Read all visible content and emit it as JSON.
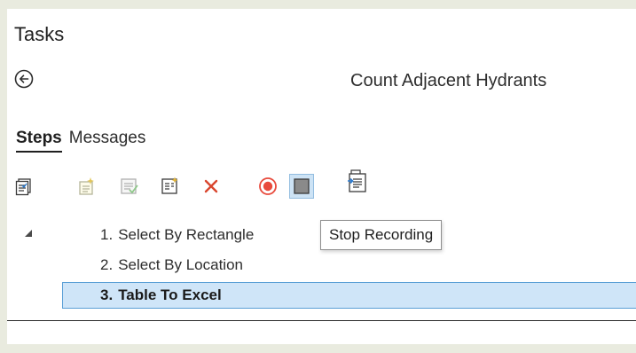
{
  "pane": {
    "title": "Tasks",
    "task_name": "Count Adjacent Hydrants"
  },
  "tabs": [
    {
      "label": "Steps",
      "active": true
    },
    {
      "label": "Messages",
      "active": false
    }
  ],
  "toolbar": {
    "icons": [
      "task-properties-icon",
      "insert-step-icon",
      "edit-step-icon",
      "step-properties-icon",
      "delete-step-icon",
      "record-icon",
      "stop-recording-icon",
      "paste-step-icon"
    ],
    "accent_record": "#e84a3c",
    "accent_delete": "#d9462e"
  },
  "tooltip": {
    "text": "Stop Recording"
  },
  "steps": [
    {
      "num": "1.",
      "label": "Select By Rectangle",
      "selected": false
    },
    {
      "num": "2.",
      "label": "Select By Location",
      "selected": false
    },
    {
      "num": "3.",
      "label": "Table To Excel",
      "selected": true
    }
  ],
  "colors": {
    "selection_bg": "#cfe5f8",
    "selection_border": "#5a9fd6",
    "hover_bg": "#cde3f5",
    "frame_bg": "#e9ebdf"
  }
}
